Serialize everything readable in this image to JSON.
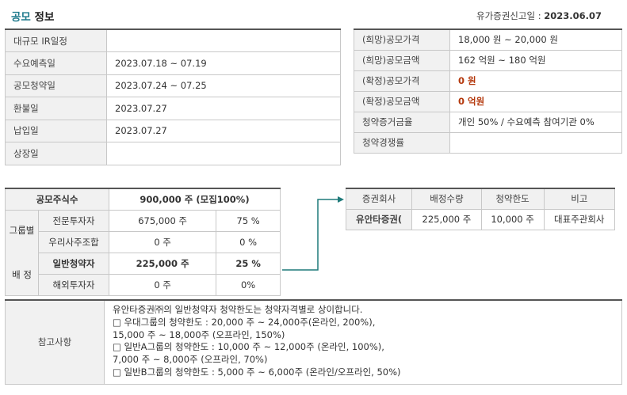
{
  "header": {
    "title_accent": "공모",
    "title_rest": "정보",
    "filing_label": "유가증권신고일 : ",
    "filing_date": "2023.06.07"
  },
  "schedule": {
    "rows": [
      {
        "label": "대규모 IR일정",
        "value": ""
      },
      {
        "label": "수요예측일",
        "value": "2023.07.18 ~ 07.19"
      },
      {
        "label": "공모청약일",
        "value": "2023.07.24 ~ 07.25"
      },
      {
        "label": "환불일",
        "value": "2023.07.27"
      },
      {
        "label": "납입일",
        "value": "2023.07.27"
      },
      {
        "label": "상장일",
        "value": ""
      }
    ]
  },
  "price": {
    "rows": [
      {
        "label": "(희망)공모가격",
        "value": "18,000 원 ~ 20,000 원"
      },
      {
        "label": "(희망)공모금액",
        "value": "162 억원  ~ 180 억원"
      },
      {
        "label": "(확정)공모가격",
        "value": "0 원"
      },
      {
        "label": "(확정)공모금액",
        "value": "0 억원"
      },
      {
        "label": "청약증거금율",
        "value": "개인 50% / 수요예측 참여기관 0%"
      },
      {
        "label": "청약경쟁률",
        "value": ""
      }
    ]
  },
  "shares": {
    "total_label": "공모주식수",
    "total_value": "900,000 주 (모집100%)",
    "group_label_1": "그룹별",
    "group_label_2": "배 정",
    "rows": [
      {
        "label": "전문투자자",
        "shares": "675,000 주",
        "pct": "75 %"
      },
      {
        "label": "우리사주조합",
        "shares": "0 주",
        "pct": "0 %"
      },
      {
        "label": "일반청약자",
        "shares": "225,000 주",
        "pct": "25 %"
      },
      {
        "label": "해외투자자",
        "shares": "0 주",
        "pct": "0%"
      }
    ]
  },
  "broker": {
    "headers": [
      "증권회사",
      "배정수량",
      "청약한도",
      "비고"
    ],
    "row": {
      "company": "유안타증권(",
      "qty": "225,000 주",
      "limit": "10,000 주",
      "note": "대표주관회사"
    }
  },
  "note": {
    "label": "참고사항",
    "lines": [
      "유안타증권㈜의 일반청약자 청약한도는 청약자격별로 상이합니다.",
      "□ 우대그룹의 청약한도 : 20,000 주 ~ 24,000주(온라인, 200%),",
      "15,000 주 ~ 18,000주 (오프라인, 150%)",
      "□ 일반A그룹의 청약한도 : 10,000 주 ~ 12,000주 (온라인, 100%),",
      "7,000 주 ~ 8,000주 (오프라인, 70%)",
      "□ 일반B그룹의 청약한도 : 5,000 주 ~ 6,000주 (온라인/오프라인, 50%)"
    ]
  },
  "colors": {
    "accent": "#1f7a8c",
    "emphasis": "#b4380c",
    "connector": "#1f7a7a"
  }
}
